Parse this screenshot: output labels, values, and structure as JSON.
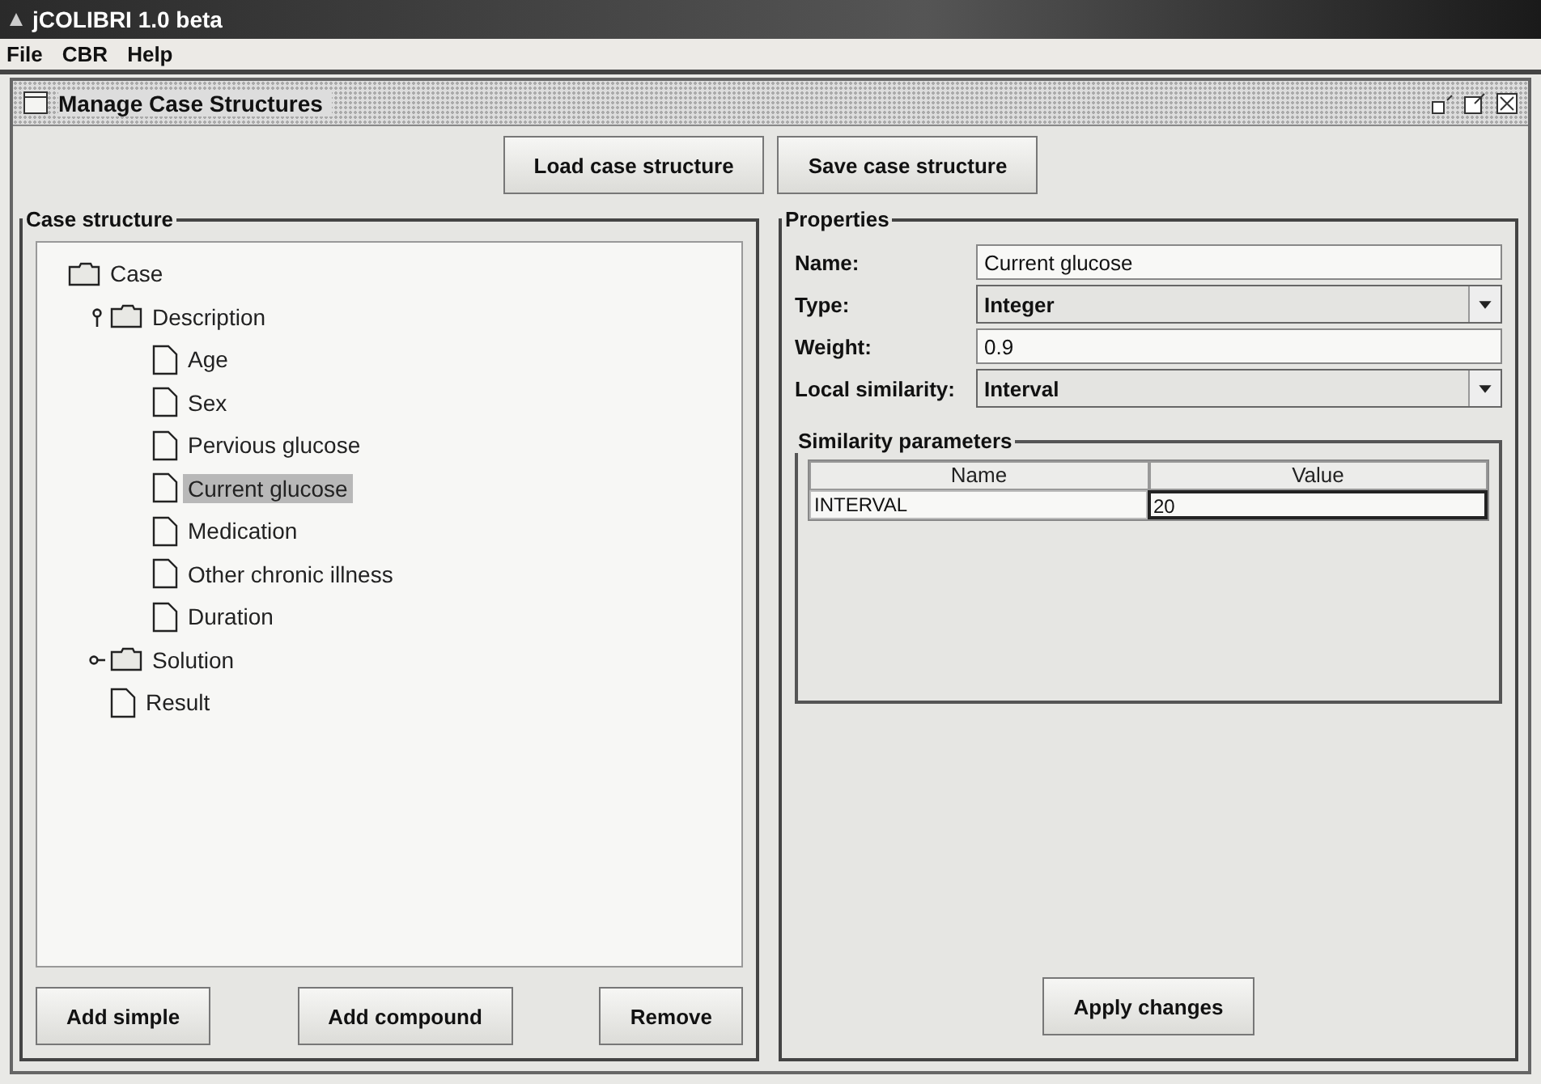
{
  "window": {
    "title": "jCOLIBRI 1.0 beta"
  },
  "menu": [
    "File",
    "CBR",
    "Help"
  ],
  "internal_frame": {
    "title": "Manage Case Structures"
  },
  "top_buttons": [
    "Load case structure",
    "Save case structure"
  ],
  "case_structure": {
    "title": "Case structure",
    "tree": [
      {
        "label": "Case",
        "kind": "folder",
        "selected": false,
        "children": [
          {
            "label": "Description",
            "kind": "folder",
            "expanded": true,
            "selected": false,
            "children": [
              {
                "label": "Age",
                "kind": "leaf",
                "selected": false
              },
              {
                "label": "Sex",
                "kind": "leaf",
                "selected": false
              },
              {
                "label": "Pervious glucose",
                "kind": "leaf",
                "selected": false
              },
              {
                "label": "Current glucose",
                "kind": "leaf",
                "selected": true
              },
              {
                "label": "Medication",
                "kind": "leaf",
                "selected": false
              },
              {
                "label": "Other chronic illness",
                "kind": "leaf",
                "selected": false
              },
              {
                "label": "Duration",
                "kind": "leaf",
                "selected": false
              }
            ]
          },
          {
            "label": "Solution",
            "kind": "folder",
            "expanded": false,
            "selected": false
          },
          {
            "label": "Result",
            "kind": "leaf",
            "selected": false
          }
        ]
      }
    ],
    "buttons": [
      "Add simple",
      "Add compound",
      "Remove"
    ]
  },
  "properties": {
    "title": "Properties",
    "fields": [
      {
        "label": "Name:",
        "kind": "text",
        "value": "Current glucose"
      },
      {
        "label": "Type:",
        "kind": "select",
        "value": "Integer"
      },
      {
        "label": "Weight:",
        "kind": "text",
        "value": "0.9"
      },
      {
        "label": "Local similarity:",
        "kind": "select",
        "value": "Interval"
      }
    ],
    "similarity_parameters": {
      "title": "Similarity parameters",
      "columns": [
        "Name",
        "Value"
      ],
      "rows": [
        {
          "cells": [
            {
              "text": "INTERVAL",
              "editing": false
            },
            {
              "text": "20",
              "editing": true
            }
          ]
        }
      ]
    },
    "apply_button": "Apply changes"
  }
}
